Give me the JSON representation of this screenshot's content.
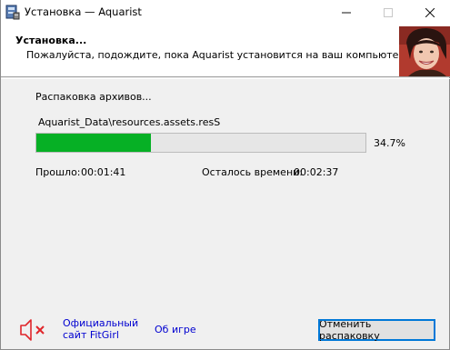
{
  "window": {
    "title": "Установка — Aquarist",
    "controls": {
      "minimize_icon": "minimize-icon",
      "maximize_icon": "maximize-icon",
      "close_icon": "close-icon"
    }
  },
  "header": {
    "title": "Установка...",
    "subtitle": "Пожалуйста, подождите, пока Aquarist установится на ваш компьютер."
  },
  "status": {
    "action": "Распаковка архивов...",
    "current_file": "Aquarist_Data\\resources.assets.resS",
    "progress_percent_label": "34.7%",
    "progress_fraction": 0.347,
    "elapsed_label": "Прошло:",
    "elapsed_value": "00:01:41",
    "remaining_label": "Осталось времени:",
    "remaining_value": "00:02:37"
  },
  "footer": {
    "speaker_icon": "speaker-muted-icon",
    "link_fitgirl": "Официальный сайт FitGirl",
    "link_about": "Об игре",
    "cancel_button": "Отменить распаковку"
  },
  "colors": {
    "progress_fill": "#06b025",
    "link": "#0000d0",
    "mute_x": "#e0262b",
    "button_border": "#0078d7"
  }
}
